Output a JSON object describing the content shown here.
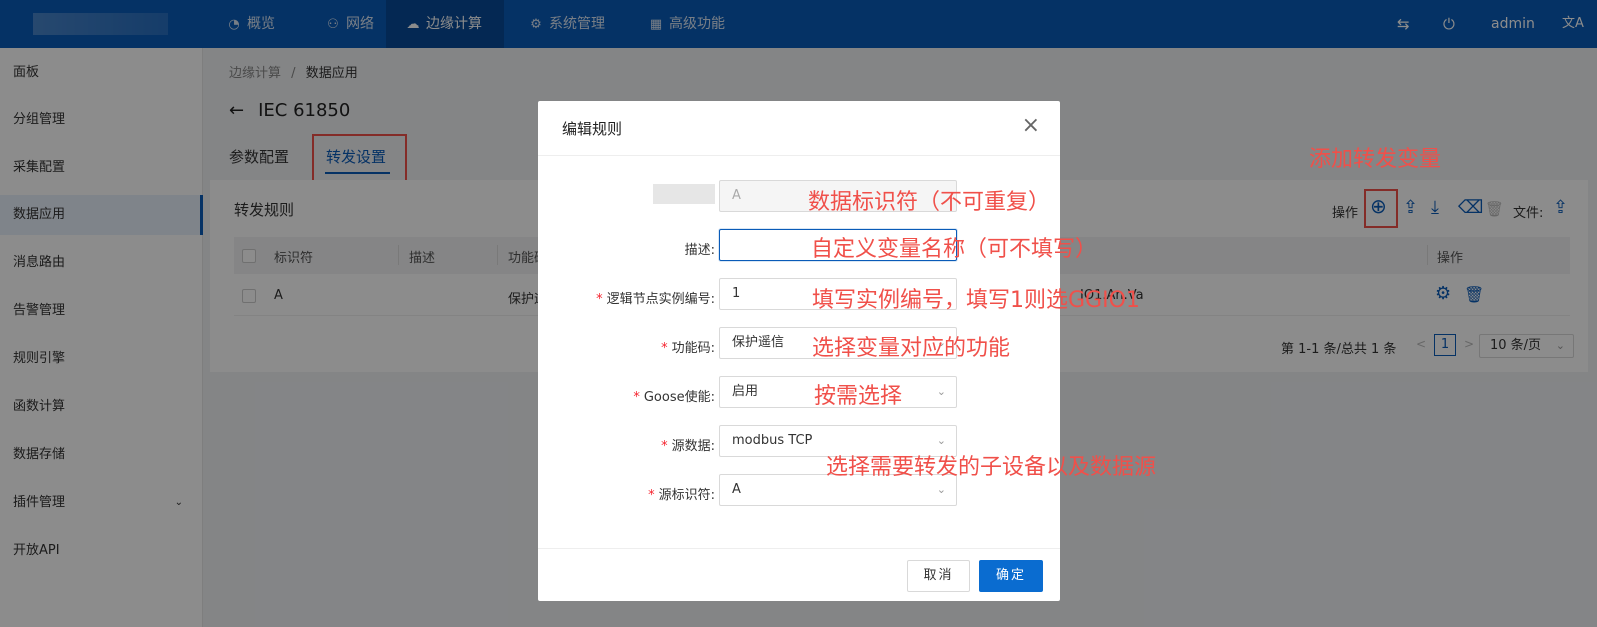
{
  "nav": {
    "items": [
      {
        "icon": "dashboard-icon",
        "glyph": "◔",
        "label": "概览"
      },
      {
        "icon": "network-icon",
        "glyph": "⚇",
        "label": "网络"
      },
      {
        "icon": "edge-cloud-icon",
        "glyph": "☁",
        "label": "边缘计算"
      },
      {
        "icon": "gear-icon",
        "glyph": "⚙",
        "label": "系统管理"
      },
      {
        "icon": "grid-icon",
        "glyph": "▦",
        "label": "高级功能"
      }
    ],
    "active_index": 2,
    "switch_glyph": "⇆",
    "power_glyph": "⏻",
    "user": "admin",
    "lang_glyph": "文A"
  },
  "sidebar": {
    "items": [
      {
        "label": "面板"
      },
      {
        "label": "分组管理"
      },
      {
        "label": "采集配置"
      },
      {
        "label": "数据应用"
      },
      {
        "label": "消息路由"
      },
      {
        "label": "告警管理"
      },
      {
        "label": "规则引擎"
      },
      {
        "label": "函数计算"
      },
      {
        "label": "数据存储"
      },
      {
        "label": "插件管理"
      },
      {
        "label": "开放API"
      }
    ],
    "active_index": 3,
    "expand_glyph": "⌄"
  },
  "breadcrumb": {
    "parent": "边缘计算",
    "sep": "/",
    "current": "数据应用"
  },
  "page": {
    "back_glyph": "←",
    "title": "IEC 61850"
  },
  "tabs": [
    {
      "label": "参数配置"
    },
    {
      "label": "转发设置"
    }
  ],
  "panel": {
    "title": "转发规则",
    "ops_label": "操作",
    "file_label": "文件:",
    "icons": {
      "add": "⊕",
      "upload": "⇪",
      "download": "⤓",
      "clear": "⌫",
      "delete": "🗑",
      "file_upload": "⇪"
    }
  },
  "table": {
    "headers": [
      "标识符",
      "描述",
      "功能码",
      "操作"
    ],
    "rows": [
      {
        "id": "A",
        "desc": "",
        "func": "保护遥",
        "extra": "IO1.An.Va"
      }
    ],
    "row_icons": {
      "settings": "⚙",
      "delete": "🗑"
    }
  },
  "pager": {
    "summary": "第 1-1 条/总共 1 条",
    "prev": "<",
    "page": "1",
    "next": ">",
    "size": "10 条/页",
    "size_arrow": "⌄"
  },
  "modal": {
    "title": "编辑规则",
    "close": "×",
    "fields": [
      {
        "label": "",
        "required": false,
        "value": "A",
        "placeholder": "",
        "disabled": true
      },
      {
        "label": "描述:",
        "required": false,
        "value": "",
        "focus": true
      },
      {
        "label": "逻辑节点实例编号:",
        "required": true,
        "value": "1"
      },
      {
        "label": "功能码:",
        "required": true,
        "value": "保护遥信",
        "select": true
      },
      {
        "label": "Goose使能:",
        "required": true,
        "value": "启用",
        "select": true
      },
      {
        "label": "源数据:",
        "required": true,
        "value": "modbus TCP",
        "select": true
      },
      {
        "label": "源标识符:",
        "required": true,
        "value": "A",
        "select": true
      }
    ],
    "required_mark": "*",
    "select_arrow": "⌄",
    "cancel": "取消",
    "ok": "确定"
  },
  "annotations": {
    "add_var": "添加转发变量",
    "identifier": "数据标识符（不可重复）",
    "custom_name": "自定义变量名称（可不填写）",
    "instance": "填写实例编号，填写1则选GGIO1",
    "function": "选择变量对应的功能",
    "as_needed": "按需选择",
    "source": "选择需要转发的子设备以及数据源"
  },
  "colors": {
    "primary": "#0a5bb8",
    "annotation": "#f0504a"
  }
}
